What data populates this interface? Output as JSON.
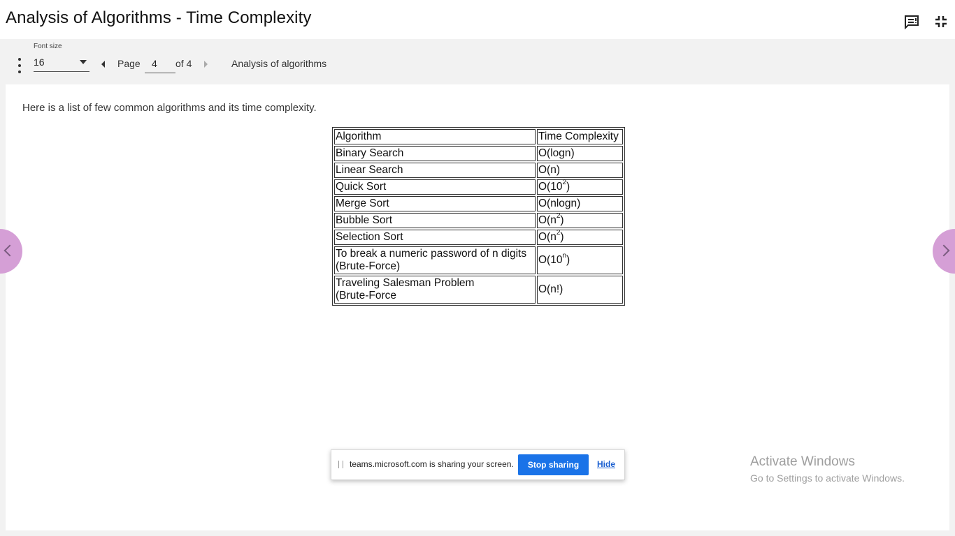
{
  "header": {
    "title": "Analysis of Algorithms - Time Complexity",
    "feedback_icon": "feedback-icon",
    "exit_fullscreen_icon": "exit-fullscreen-icon"
  },
  "toolbar": {
    "menu_icon": "more-vert-icon",
    "font_size_label": "Font size",
    "font_size_value": "16",
    "page_label": "Page",
    "page_value": "4",
    "page_of": "of 4",
    "section_name": "Analysis of algorithms"
  },
  "content": {
    "intro": "Here is a list of few common algorithms and its time complexity.",
    "table": {
      "headers": [
        "Algorithm",
        "Time Complexity"
      ],
      "rows": [
        {
          "algorithm": "Binary Search",
          "complexity": "O(logn)"
        },
        {
          "algorithm": "Linear Search",
          "complexity": "O(n)"
        },
        {
          "algorithm": "Quick Sort",
          "complexity": "O(10",
          "sup": "2",
          "after": ")"
        },
        {
          "algorithm": "Merge Sort",
          "complexity": "O(nlogn)"
        },
        {
          "algorithm": "Bubble Sort",
          "complexity": "O(n",
          "sup": "2",
          "after": ")"
        },
        {
          "algorithm": "Selection Sort",
          "complexity": "O(n",
          "sup": "2",
          "after": ")"
        },
        {
          "algorithm": "To break a numeric password of n digits",
          "algorithm_line2": "(Brute-Force)",
          "complexity": "O(10",
          "sup": "n",
          "after": ")"
        },
        {
          "algorithm": "Traveling Salesman Problem",
          "algorithm_line2": "(Brute-Force",
          "complexity": "O(n!)"
        }
      ]
    }
  },
  "nav": {
    "prev_icon": "chevron-left-icon",
    "next_icon": "chevron-right-icon"
  },
  "share_bar": {
    "message": "teams.microsoft.com is sharing your screen.",
    "stop_label": "Stop sharing",
    "hide_label": "Hide"
  },
  "watermark": {
    "line1": "Activate Windows",
    "line2": "Go to Settings to activate Windows."
  },
  "colors": {
    "accent_blue": "#1a73e8",
    "nav_circle": "#d59fd6",
    "toolbar_bg": "#f2f2f2"
  }
}
